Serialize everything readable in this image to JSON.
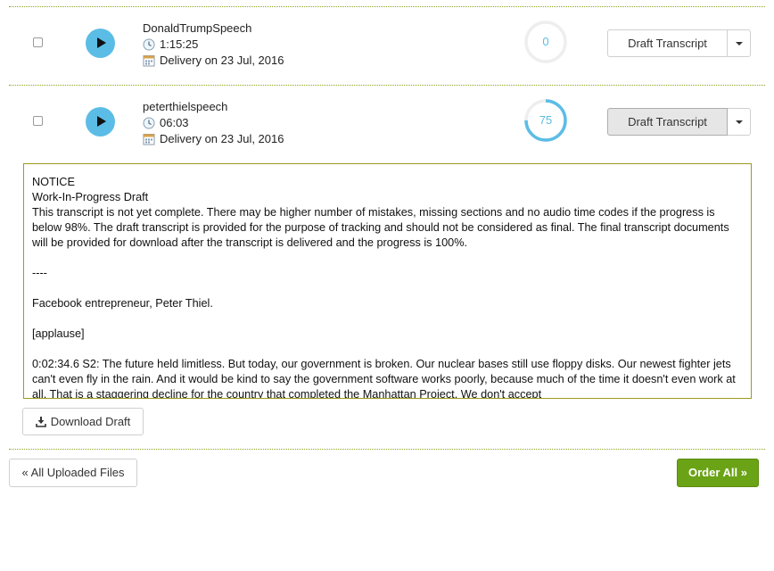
{
  "files": [
    {
      "name": "DonaldTrumpSpeech",
      "duration": "1:15:25",
      "delivery": "Delivery on 23 Jul, 2016",
      "progress_text": "0",
      "progress": 0,
      "action_label": "Draft Transcript"
    },
    {
      "name": "peterthielspeech",
      "duration": "06:03",
      "delivery": "Delivery on 23 Jul, 2016",
      "progress_text": "75",
      "progress": 75,
      "action_label": "Draft Transcript"
    }
  ],
  "notice": {
    "heading": "NOTICE",
    "subheading": "Work-In-Progress Draft",
    "body": "This transcript is not yet complete. There may be higher number of mistakes, missing sections and no audio time codes if the progress is below 98%. The draft transcript is provided for the purpose of tracking and should not be considered as final. The final transcript documents will be provided for download after the transcript is delivered and the progress is 100%.",
    "separator": "----",
    "line1": "Facebook entrepreneur, Peter Thiel.",
    "line2": "[applause]",
    "line3": "0:02:34.6 S2: The future held limitless. But today, our government is broken. Our nuclear bases still use floppy disks. Our newest fighter jets can't even fly in the rain. And it would be kind to say the government software works poorly, because much of the time it doesn't even work at all. That is a staggering decline for the country that completed the Manhattan Project. We don't accept"
  },
  "download_label": "Download Draft",
  "back_label": "« All Uploaded Files",
  "order_label": "Order All »",
  "colors": {
    "accent_blue": "#5bbde6",
    "order_green": "#6aa316",
    "divider_olive": "#8aa61c",
    "notice_border": "#a09a1e"
  },
  "icons": {
    "play": "play-icon",
    "clock": "clock-icon",
    "calendar": "calendar-icon",
    "download": "download-icon",
    "caret": "caret-down-icon"
  }
}
